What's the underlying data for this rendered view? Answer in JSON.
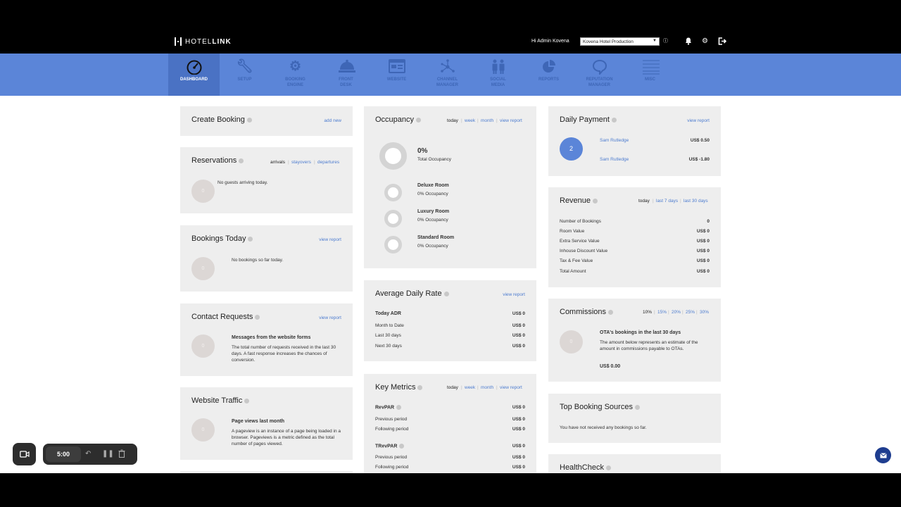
{
  "header": {
    "logo_light": "HOTEL",
    "logo_bold": "LINK",
    "greeting": "Hi Admin Kovena",
    "hotel_select": "Kovena Hotel Production"
  },
  "nav": [
    {
      "label1": "DASHBOARD",
      "label2": "",
      "icon": "speedometer-icon"
    },
    {
      "label1": "SETUP",
      "label2": "",
      "icon": "wrench-icon"
    },
    {
      "label1": "BOOKING",
      "label2": "ENGINE",
      "icon": "gear-icon"
    },
    {
      "label1": "FRONT",
      "label2": "DESK",
      "icon": "bell-icon"
    },
    {
      "label1": "WEBSITE",
      "label2": "",
      "icon": "browser-icon"
    },
    {
      "label1": "CHANNEL",
      "label2": "MANAGER",
      "icon": "network-icon"
    },
    {
      "label1": "SOCIAL",
      "label2": "MEDIA",
      "icon": "people-icon"
    },
    {
      "label1": "REPORTS",
      "label2": "",
      "icon": "pie-chart-icon"
    },
    {
      "label1": "REPUTATION",
      "label2": "MANAGER",
      "icon": "speech-bubble-icon"
    },
    {
      "label1": "MISC",
      "label2": "",
      "icon": "list-icon"
    }
  ],
  "create_booking": {
    "title": "Create Booking",
    "add_new": "add new"
  },
  "reservations": {
    "title": "Reservations",
    "tab_arrivals": "arrivals",
    "tab_stayovers": "stayovers",
    "tab_departures": "departures",
    "count": "0",
    "message": "No guests arriving today."
  },
  "bookings_today": {
    "title": "Bookings Today",
    "view_report": "view report",
    "count": "0",
    "message": "No bookings so far today."
  },
  "contact_requests": {
    "title": "Contact Requests",
    "view_report": "view report",
    "count": "0",
    "heading": "Messages from the website forms",
    "text": "The total number of requests received in the last 30 days. A fast response increases the chances of conversion."
  },
  "website_traffic": {
    "title": "Website Traffic",
    "count": "0",
    "heading": "Page views last month",
    "text": "A pageview is an instance of a page being loaded in a browser. Pageviews is a metric defined as the total number of pages viewed."
  },
  "occupancy": {
    "title": "Occupancy",
    "tab_today": "today",
    "tab_week": "week",
    "tab_month": "month",
    "view_report": "view report",
    "total_pct": "0%",
    "total_label": "Total Occupancy",
    "rooms": [
      {
        "name": "Deluxe Room",
        "value": "0% Occupancy"
      },
      {
        "name": "Luxury Room",
        "value": "0% Occupancy"
      },
      {
        "name": "Standard Room",
        "value": "0% Occupancy"
      }
    ]
  },
  "adr": {
    "title": "Average Daily Rate",
    "view_report": "view report",
    "rows": [
      {
        "label": "Today ADR",
        "value": "US$ 0"
      },
      {
        "label": "Month to Date",
        "value": "US$ 0"
      },
      {
        "label": "Last 30 days",
        "value": "US$ 0"
      },
      {
        "label": "Next 30 days",
        "value": "US$ 0"
      }
    ]
  },
  "key_metrics": {
    "title": "Key Metrics",
    "tab_today": "today",
    "tab_week": "week",
    "tab_month": "month",
    "view_report": "view report",
    "revpar": "RevPAR",
    "revpar_value": "US$ 0",
    "prev": "Previous period",
    "prev_value": "US$ 0",
    "next": "Following period",
    "next_value": "US$ 0",
    "trevpar": "TRevPAR",
    "trevpar_value": "US$ 0",
    "prev2_value": "US$ 0",
    "next2_value": "US$ 0"
  },
  "daily_payment": {
    "title": "Daily Payment",
    "view_report": "view report",
    "count": "2",
    "rows": [
      {
        "name": "Sam Rutledge",
        "amount": "US$ 0.50"
      },
      {
        "name": "Sam Rutledge",
        "amount": "US$ -1.80"
      }
    ]
  },
  "revenue": {
    "title": "Revenue",
    "tab_today": "today",
    "tab_7": "last 7 days",
    "tab_30": "last 30 days",
    "rows": [
      {
        "label": "Number of Bookings",
        "value": "0"
      },
      {
        "label": "Room Value",
        "value": "US$ 0"
      },
      {
        "label": "Extra Service Value",
        "value": "US$ 0"
      },
      {
        "label": "Inhouse Discount Value",
        "value": "US$ 0"
      },
      {
        "label": "Tax & Fee Value",
        "value": "US$ 0"
      },
      {
        "label": "Total Amount",
        "value": "US$ 0"
      }
    ]
  },
  "commissions": {
    "title": "Commissions",
    "rates": [
      "10%",
      "15%",
      "20%",
      "25%",
      "30%"
    ],
    "count": "0",
    "heading": "OTA's bookings in the last 30 days",
    "text": "The amount below represents an estimate of the amount in commissions payable to OTAs.",
    "amount": "US$ 0.00"
  },
  "top_sources": {
    "title": "Top Booking Sources",
    "message": "You have not received any bookings so far."
  },
  "healthcheck": {
    "title": "HealthCheck"
  },
  "recorder": {
    "timer": "5:00"
  },
  "colors": {
    "nav": "#5b85d8",
    "nav_active": "#4a72c4",
    "link": "#4d7ccf",
    "card": "#eeeeee",
    "payment_badge": "#5b85d8"
  }
}
